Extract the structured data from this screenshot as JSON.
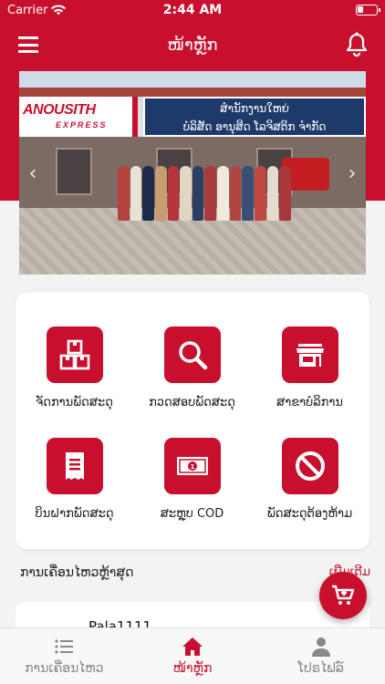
{
  "status": {
    "carrier": "Carrier",
    "time": "2:44 AM"
  },
  "header": {
    "title": "ໜ້າຫຼັກ"
  },
  "banner": {
    "logo": "ANOUSITH",
    "logo_sub": "EXPRESS",
    "sign_line1": "ສໍານັກງານໃຫຍ່",
    "sign_line2": "ບໍລິສັດ ອານຸສິດ ໂລຈິສຕິກ ຈໍາກັດ"
  },
  "menu": {
    "items": [
      {
        "label": "ຈັດການພັດສະດຸ",
        "icon": "boxes-icon"
      },
      {
        "label": "ກວດສອບພັດສະດຸ",
        "icon": "search-icon"
      },
      {
        "label": "ສາຂາບໍລິການ",
        "icon": "store-icon"
      },
      {
        "label": "ບິນຝາກພັດສະດຸ",
        "icon": "receipt-icon"
      },
      {
        "label": "ສະຫຼຸບ COD",
        "icon": "banknote-icon"
      },
      {
        "label": "ພັດສະດຸຕ້ອງຫ້າມ",
        "icon": "prohibited-icon"
      }
    ]
  },
  "recent": {
    "title": "ການເຄື່ອນໄຫວຫຼ້າສຸດ",
    "more": "ເພີ່ມເຕີມ",
    "first_code": "Pala1111"
  },
  "tabs": [
    {
      "label": "ການເຄື່ອນໄຫວ",
      "icon": "list-icon",
      "active": false
    },
    {
      "label": "ໜ້າຫຼັກ",
      "icon": "home-icon",
      "active": true
    },
    {
      "label": "ໂປຣໄຟລ໌",
      "icon": "profile-icon",
      "active": false
    }
  ],
  "colors": {
    "brand": "#c8102e",
    "background": "#f3f3f3"
  }
}
